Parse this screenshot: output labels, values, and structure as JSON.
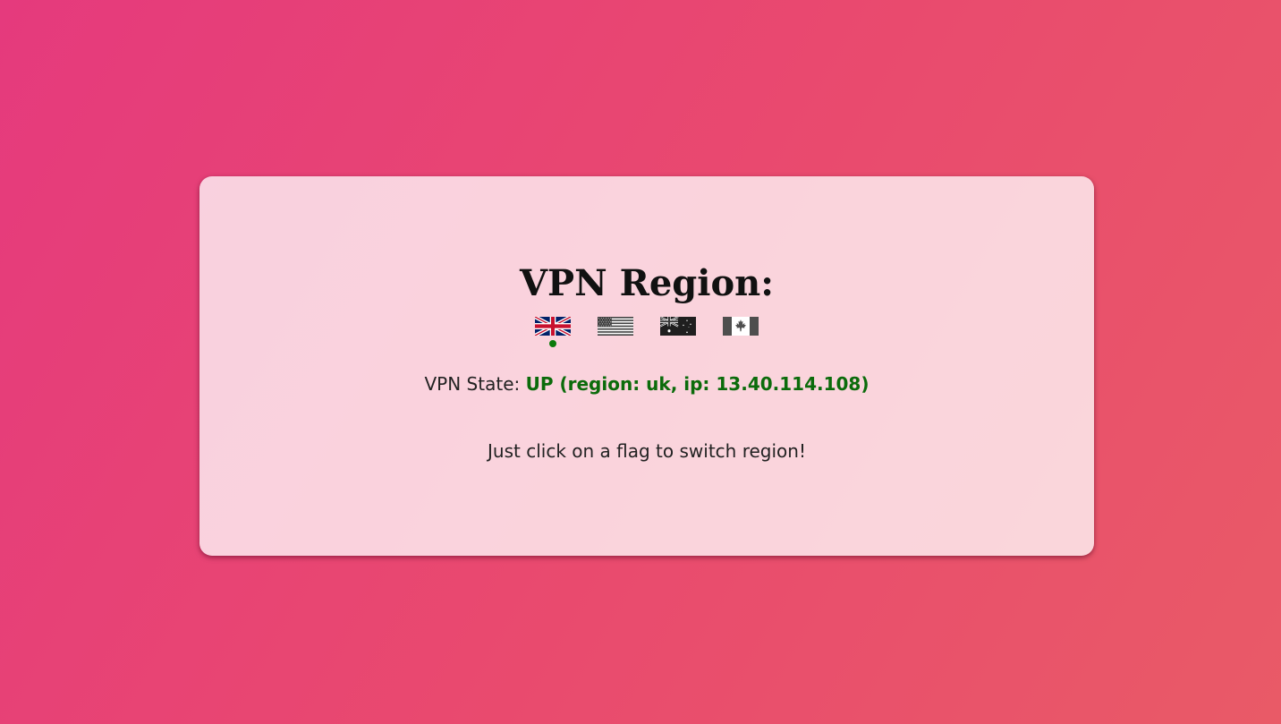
{
  "page": {
    "title": "VPN Region:",
    "regions": [
      {
        "code": "uk",
        "icon": "uk-flag-icon",
        "active": true
      },
      {
        "code": "us",
        "icon": "us-flag-icon",
        "active": false
      },
      {
        "code": "au",
        "icon": "australia-flag-icon",
        "active": false
      },
      {
        "code": "ca",
        "icon": "canada-flag-icon",
        "active": false
      }
    ],
    "state_label": "VPN State:",
    "state_value": "UP (region: uk, ip: 13.40.114.108)",
    "hint": "Just click on a flag to switch region!"
  },
  "colors": {
    "background_start": "#e53a7d",
    "background_end": "#e95a67",
    "state_ok": "#0b6b0b",
    "active_indicator": "#0a7a0a"
  }
}
